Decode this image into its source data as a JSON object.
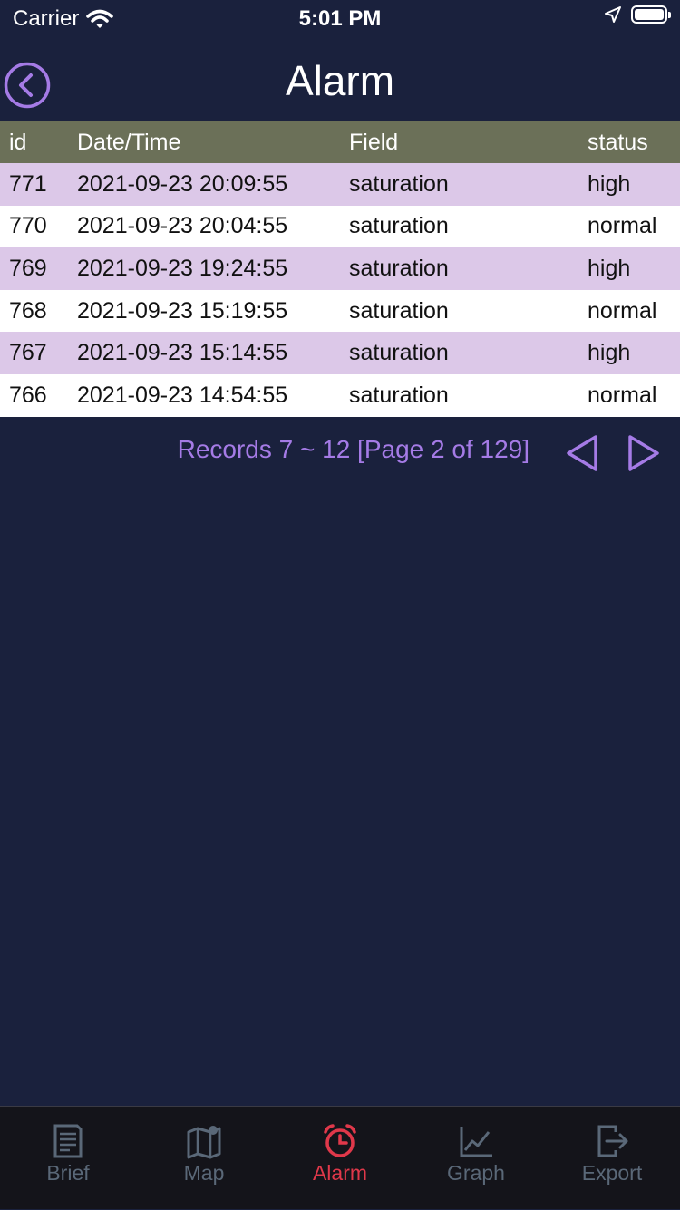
{
  "status_bar": {
    "carrier": "Carrier",
    "time": "5:01 PM"
  },
  "nav": {
    "title": "Alarm",
    "back_icon": "chevron-left-circle-icon"
  },
  "table": {
    "headers": [
      "id",
      "Date/Time",
      "Field",
      "status"
    ],
    "rows": [
      {
        "id": "771",
        "datetime": "2021-09-23 20:09:55",
        "field": "saturation",
        "status": "high"
      },
      {
        "id": "770",
        "datetime": "2021-09-23 20:04:55",
        "field": "saturation",
        "status": "normal"
      },
      {
        "id": "769",
        "datetime": "2021-09-23 19:24:55",
        "field": "saturation",
        "status": "high"
      },
      {
        "id": "768",
        "datetime": "2021-09-23 15:19:55",
        "field": "saturation",
        "status": "normal"
      },
      {
        "id": "767",
        "datetime": "2021-09-23 15:14:55",
        "field": "saturation",
        "status": "high"
      },
      {
        "id": "766",
        "datetime": "2021-09-23 14:54:55",
        "field": "saturation",
        "status": "normal"
      }
    ]
  },
  "pager": {
    "text": "Records 7 ~ 12 [Page 2 of 129]",
    "prev_icon": "triangle-left-icon",
    "next_icon": "triangle-right-icon"
  },
  "tabs": [
    {
      "label": "Brief",
      "icon": "document-icon",
      "active": false
    },
    {
      "label": "Map",
      "icon": "map-icon",
      "active": false
    },
    {
      "label": "Alarm",
      "icon": "alarm-clock-icon",
      "active": true
    },
    {
      "label": "Graph",
      "icon": "line-graph-icon",
      "active": false
    },
    {
      "label": "Export",
      "icon": "export-icon",
      "active": false
    }
  ],
  "colors": {
    "background": "#1a213d",
    "accent": "#a57be6",
    "header_row": "#6b7058",
    "odd_row": "#dcc8e8",
    "even_row": "#ffffff",
    "active_tab": "#e0384a",
    "inactive_tab": "#5a6878"
  }
}
